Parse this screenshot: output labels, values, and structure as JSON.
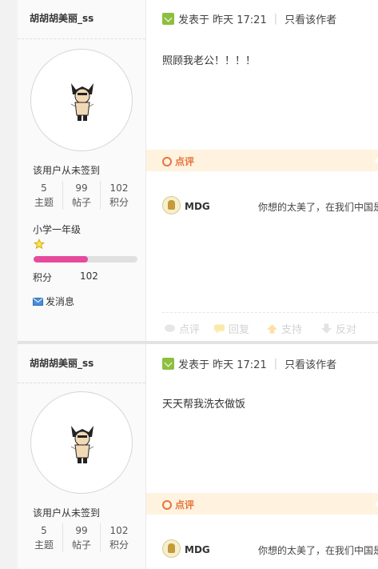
{
  "posts": [
    {
      "user": {
        "name": "胡胡胡美丽_ss",
        "signin": "该用户从未签到",
        "stats": [
          {
            "value": "5",
            "label": "主题"
          },
          {
            "value": "99",
            "label": "帖子"
          },
          {
            "value": "102",
            "label": "积分"
          }
        ],
        "level": "小学一年级",
        "level_progress": 0.52,
        "points_label": "积分",
        "points_value": "102",
        "send_message": "发消息"
      },
      "header": {
        "posted": "发表于 昨天 17:21",
        "only_author": "只看该作者"
      },
      "body": "照顾我老公！！！！",
      "comment_label": "点评",
      "comment": {
        "user": "MDG",
        "text": "你想的太美了，在我们中国是"
      },
      "actions": [
        "点评",
        "回复",
        "支持",
        "反对"
      ]
    },
    {
      "user": {
        "name": "胡胡胡美丽_ss",
        "signin": "该用户从未签到",
        "stats": [
          {
            "value": "5",
            "label": "主题"
          },
          {
            "value": "99",
            "label": "帖子"
          },
          {
            "value": "102",
            "label": "积分"
          }
        ]
      },
      "header": {
        "posted": "发表于 昨天 17:21",
        "only_author": "只看该作者"
      },
      "body": "天天帮我洗衣做饭",
      "comment_label": "点评",
      "comment": {
        "user": "MDG",
        "text": "你想的太美了，在我们中国是"
      }
    }
  ],
  "colors": {
    "accent": "#e8733c",
    "progress": "#e64a9c",
    "time_icon": "#8dbf3f",
    "comment_bar": "#fff3e0"
  }
}
